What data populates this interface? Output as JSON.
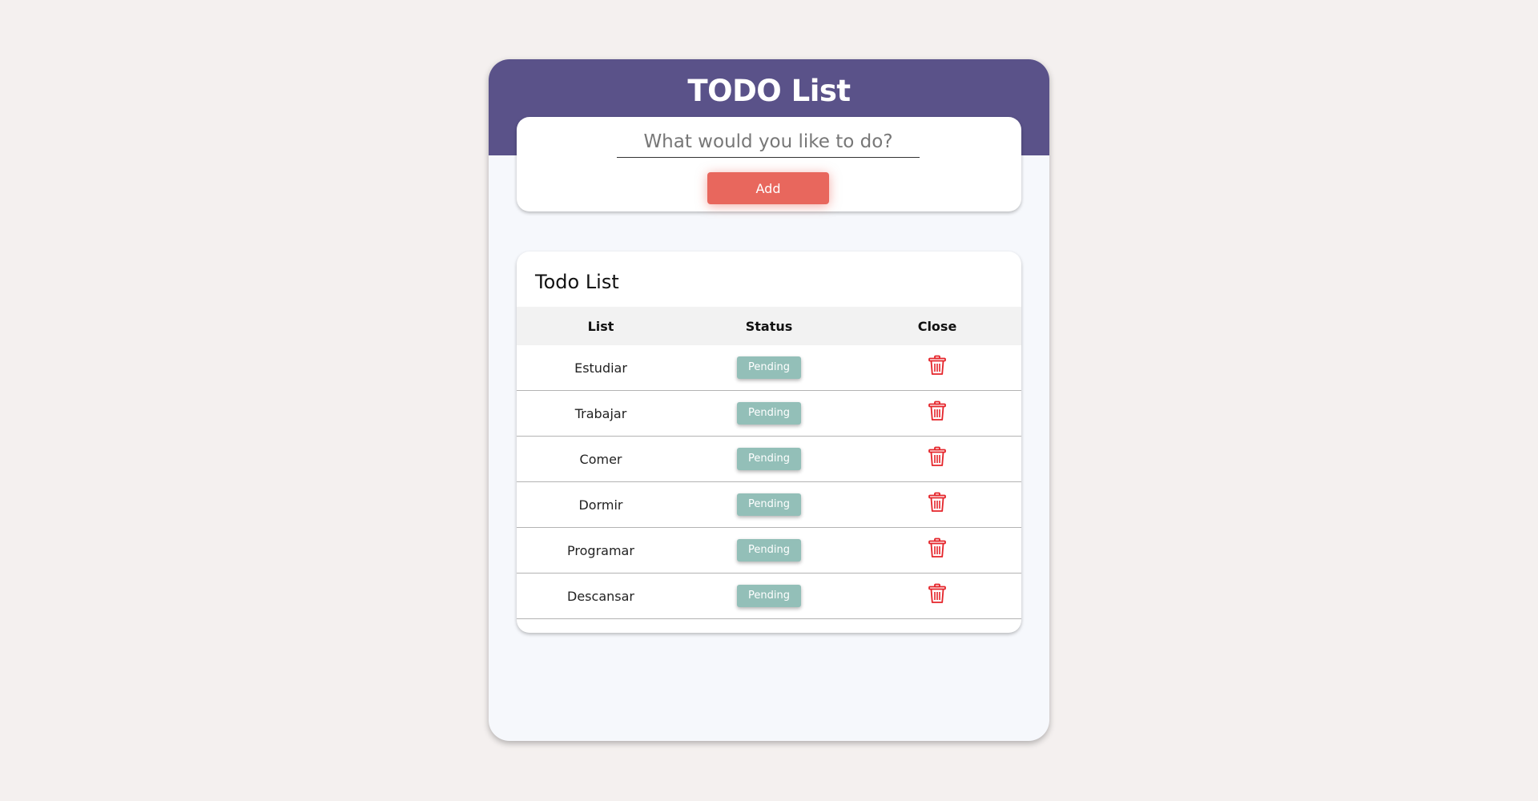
{
  "app": {
    "title": "TODO List"
  },
  "input": {
    "placeholder": "What would you like to do?",
    "value": "",
    "add_label": "Add"
  },
  "list": {
    "heading": "Todo List",
    "columns": [
      "List",
      "Status",
      "Close"
    ],
    "rows": [
      {
        "task": "Estudiar",
        "status": "Pending",
        "action_icon": "trash-icon"
      },
      {
        "task": "Trabajar",
        "status": "Pending",
        "action_icon": "trash-icon"
      },
      {
        "task": "Comer",
        "status": "Pending",
        "action_icon": "trash-icon"
      },
      {
        "task": "Dormir",
        "status": "Pending",
        "action_icon": "trash-icon"
      },
      {
        "task": "Programar",
        "status": "Pending",
        "action_icon": "trash-icon"
      },
      {
        "task": "Descansar",
        "status": "Pending",
        "action_icon": "trash-icon"
      }
    ]
  },
  "colors": {
    "header": "#5a5289",
    "add_button": "#e8675d",
    "status_badge": "#93bfb8",
    "trash_icon": "#e5242a",
    "page_background": "#f4f0ef",
    "card_background": "#f6f8fc"
  }
}
